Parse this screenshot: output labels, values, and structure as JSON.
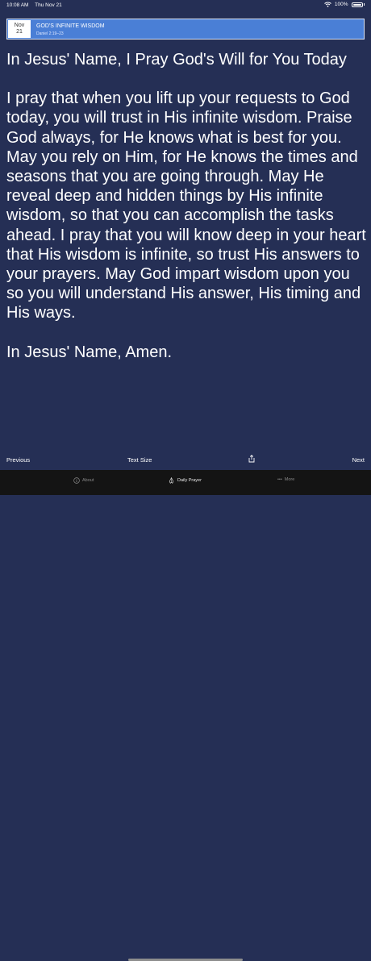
{
  "status": {
    "time": "10:08 AM",
    "date": "Thu Nov 21",
    "battery": "100%"
  },
  "header": {
    "month": "Nov",
    "day": "21",
    "title": "GOD'S INFINITE WISDOM",
    "verse": "Daniel 2:19–23"
  },
  "prayer": {
    "heading": "In Jesus' Name, I Pray God's Will for You Today",
    "body": "I pray that when you lift up your requests to God today, you will trust in His infinite wisdom. Praise God always, for He knows what is best for you. May you rely on Him, for He knows the times and seasons that you are going through. May He reveal deep and hidden things by His infinite wisdom, so that you can accomplish the tasks ahead. I pray that you will know deep in your heart that His wisdom is infinite, so trust His answers to your prayers. May God impart wisdom upon you so you will understand His answer, His timing and His ways.",
    "closing": "In Jesus' Name, Amen."
  },
  "toolbar": {
    "previous": "Previous",
    "text_size": "Text Size",
    "next": "Next"
  },
  "tabs": {
    "about": "About",
    "daily_prayer": "Daily Prayer",
    "more": "More"
  },
  "icons": {
    "share": "share-icon",
    "info": "info-icon",
    "prayer": "praying-hands-icon",
    "more": "ellipsis-icon"
  }
}
